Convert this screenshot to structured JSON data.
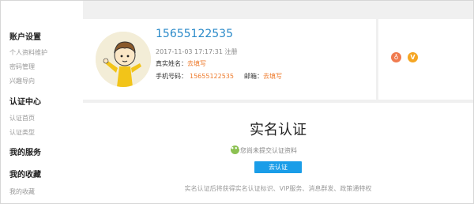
{
  "sidebar": {
    "sections": [
      {
        "title": "账户设置",
        "items": [
          "个人资料维护",
          "密码管理",
          "兴趣导向"
        ]
      },
      {
        "title": "认证中心",
        "items": [
          "认证首页",
          "认证类型"
        ]
      },
      {
        "title": "我的服务",
        "items": []
      },
      {
        "title": "我的收藏",
        "items": [
          "我的收藏"
        ]
      }
    ]
  },
  "profile": {
    "phone_title": "15655122535",
    "registered": "2017-11-03 17:17:31 注册",
    "real_name_label": "真实姓名：",
    "real_name_value": "去填写",
    "mobile_label": "手机号码：",
    "mobile_value": "15655122535",
    "email_label": "邮箱：",
    "email_value": "去填写"
  },
  "badges": {
    "medal_glyph": "♁",
    "v_glyph": "V"
  },
  "verify": {
    "title": "实名认证",
    "status_icon_glyph": "•••",
    "status_text": "您尚未提交认证资料",
    "button_label": "去认证",
    "description": "实名认证后将获得实名认证标识、VIP服务、消息群发、政策通特权"
  }
}
